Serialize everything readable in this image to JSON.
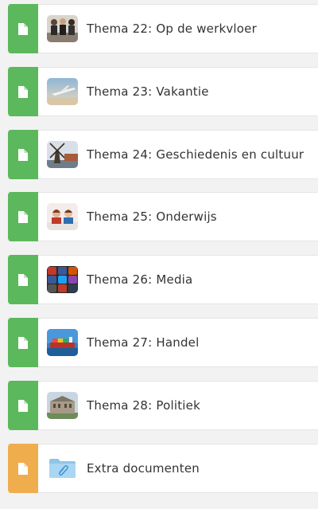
{
  "colors": {
    "section_badge": "#5cb85c",
    "folder_badge": "#f0ad4e",
    "badge_icon": "#ffffff"
  },
  "items": [
    {
      "label": "Thema 22: Op de werkvloer",
      "badge_icon": "file-icon",
      "thumbnail": "office-workers-thumbnail"
    },
    {
      "label": "Thema 23: Vakantie",
      "badge_icon": "file-icon",
      "thumbnail": "airplane-thumbnail"
    },
    {
      "label": "Thema 24: Geschiedenis en cultuur",
      "badge_icon": "file-icon",
      "thumbnail": "windmill-thumbnail"
    },
    {
      "label": "Thema 25: Onderwijs",
      "badge_icon": "file-icon",
      "thumbnail": "students-thumbnail"
    },
    {
      "label": "Thema 26: Media",
      "badge_icon": "file-icon",
      "thumbnail": "social-media-thumbnail"
    },
    {
      "label": "Thema 27: Handel",
      "badge_icon": "file-icon",
      "thumbnail": "cargo-ship-thumbnail"
    },
    {
      "label": "Thema 28: Politiek",
      "badge_icon": "file-icon",
      "thumbnail": "parliament-thumbnail"
    },
    {
      "label": "Extra documenten",
      "badge_icon": "file-icon",
      "thumbnail": "folder-attachment-icon"
    }
  ]
}
